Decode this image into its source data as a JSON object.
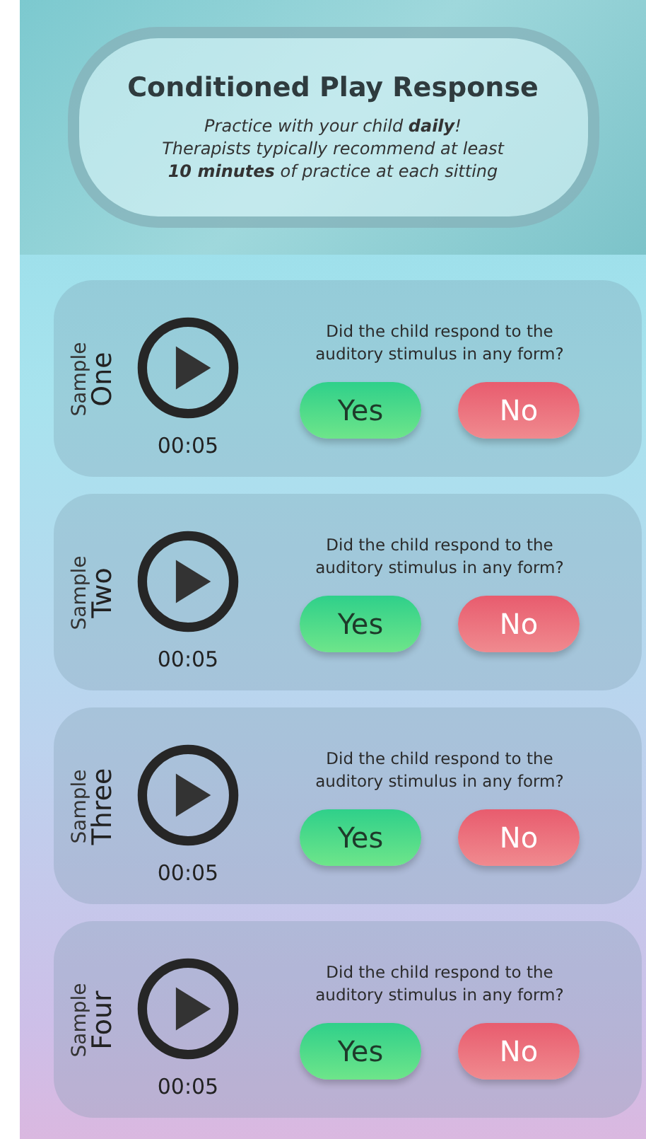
{
  "header": {
    "title": "Conditioned Play Response",
    "lines": [
      "Practice with your child **daily**!",
      "Therapists typically recommend at least",
      "**10 minutes** of practice at each sitting"
    ]
  },
  "samples": [
    {
      "label": "Sample",
      "name": "One",
      "time": "00:05",
      "question": "Did the child respond to the auditory stimulus in any form?",
      "yes": "Yes",
      "no": "No"
    },
    {
      "label": "Sample",
      "name": "Two",
      "time": "00:05",
      "question": "Did the child respond to the auditory stimulus in any form?",
      "yes": "Yes",
      "no": "No"
    },
    {
      "label": "Sample",
      "name": "Three",
      "time": "00:05",
      "question": "Did the child respond to the auditory stimulus in any form?",
      "yes": "Yes",
      "no": "No"
    },
    {
      "label": "Sample",
      "name": "Four",
      "time": "00:05",
      "question": "Did the child respond to the auditory stimulus in any form?",
      "yes": "Yes",
      "no": "No"
    }
  ]
}
